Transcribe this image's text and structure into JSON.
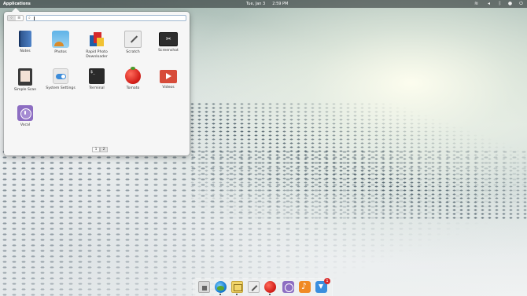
{
  "panel": {
    "applications_label": "Applications",
    "date": "Tue, Jan  3",
    "time": "2:59 PM",
    "indicators": [
      {
        "name": "wifi-icon",
        "glyph": "≋"
      },
      {
        "name": "sound-icon",
        "glyph": "◂"
      },
      {
        "name": "bluetooth-icon",
        "glyph": "ᛒ"
      },
      {
        "name": "battery-icon",
        "glyph": "▮"
      },
      {
        "name": "notifications-icon",
        "glyph": "●"
      },
      {
        "name": "power-icon",
        "glyph": "⏻"
      }
    ]
  },
  "launcher": {
    "view_modes": [
      "grid",
      "category"
    ],
    "search": {
      "value": "",
      "placeholder": ""
    },
    "apps": [
      {
        "label": "Notes",
        "icon": "notes-icon"
      },
      {
        "label": "Photos",
        "icon": "photos-icon"
      },
      {
        "label": "Rapid Photo\nDownloader",
        "icon": "rapid-photo-downloader-icon"
      },
      {
        "label": "Scratch",
        "icon": "scratch-icon"
      },
      {
        "label": "Screenshot",
        "icon": "screenshot-icon"
      },
      {
        "label": "Simple Scan",
        "icon": "simple-scan-icon"
      },
      {
        "label": "System Settings",
        "icon": "system-settings-icon"
      },
      {
        "label": "Terminal",
        "icon": "terminal-icon"
      },
      {
        "label": "Tomato",
        "icon": "tomato-icon"
      },
      {
        "label": "Videos",
        "icon": "videos-icon"
      },
      {
        "label": "Vocal",
        "icon": "vocal-icon"
      }
    ],
    "pages": [
      "1",
      "2"
    ],
    "current_page": "2"
  },
  "dock": {
    "items": [
      {
        "name": "files-icon"
      },
      {
        "name": "web-browser-icon"
      },
      {
        "name": "mail-icon"
      },
      {
        "name": "scratch-icon"
      },
      {
        "name": "tomato-icon"
      },
      {
        "name": "vocal-icon"
      },
      {
        "name": "music-icon"
      },
      {
        "name": "updates-icon",
        "badge": "1"
      }
    ]
  }
}
